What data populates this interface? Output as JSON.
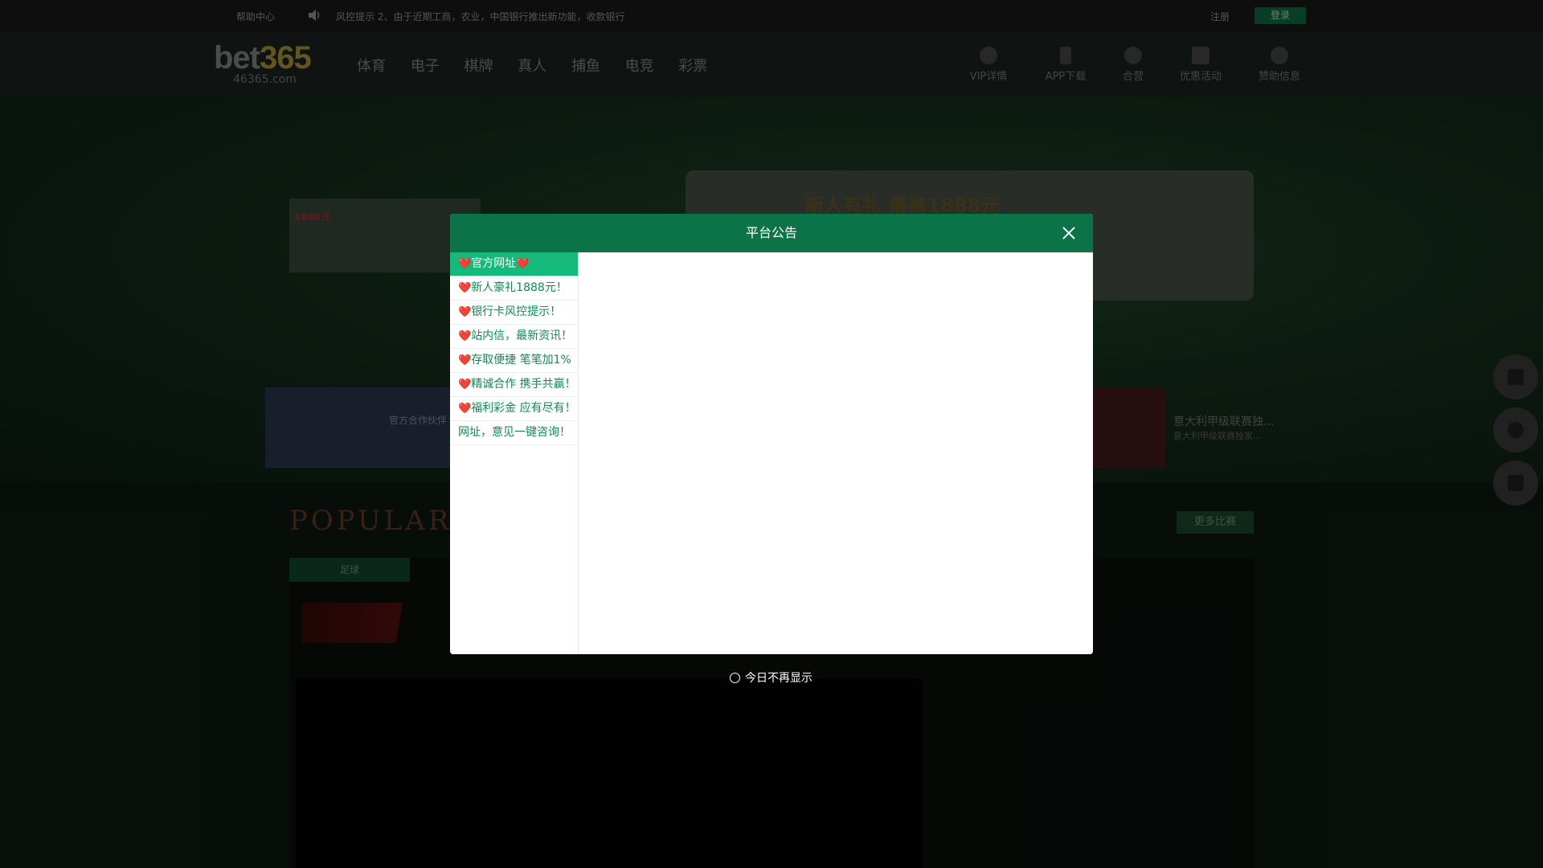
{
  "topbar": {
    "help": "帮助中心",
    "marquee": "风控提示     2、由于近期工商，农业，中国银行推出新功能，收款银行",
    "register": "注册",
    "login": "登录"
  },
  "header": {
    "logo_brand_a": "bet",
    "logo_brand_b": "365",
    "logo_sub": "46365.com",
    "nav": [
      "体育",
      "电子",
      "棋牌",
      "真人",
      "捕鱼",
      "电竞",
      "彩票"
    ],
    "right_nav": [
      "VIP详情",
      "APP下载",
      "合营",
      "优惠活动",
      "赞助信息"
    ]
  },
  "hero": {
    "promo1_text": "1888元",
    "promo2_text": "新人有礼 最高1888元",
    "partner_text": "官方合作伙伴",
    "news_title": "意大利甲级联赛独...",
    "news_sub": "意大利甲级联赛独家..."
  },
  "popular": {
    "title": "POPULAR",
    "more": "更多比赛",
    "tab": "足球"
  },
  "modal": {
    "title": "平台公告",
    "items": [
      {
        "heart": "❤️",
        "label": "官方网址",
        "heart_end": "❤️"
      },
      {
        "heart": "❤️",
        "label": "新人豪礼1888元！",
        "heart_end": ""
      },
      {
        "heart": "❤️",
        "label": "银行卡风控提示！",
        "heart_end": ""
      },
      {
        "heart": "❤️",
        "label": "站内信，最新资讯！",
        "heart_end": ""
      },
      {
        "heart": "❤️",
        "label": "存取便捷 笔笔加1%",
        "heart_end": ""
      },
      {
        "heart": "❤️",
        "label": "精诚合作 携手共赢！",
        "heart_end": ""
      },
      {
        "heart": "❤️",
        "label": "福利彩金 应有尽有！",
        "heart_end": ""
      },
      {
        "heart": "",
        "label": "网址，意见一键咨询！",
        "heart_end": ""
      }
    ],
    "dont_show": "今日不再显示"
  },
  "colors": {
    "modal_header": "#0b7347",
    "menu_active": "#15b97a",
    "menu_text": "#108a56"
  }
}
